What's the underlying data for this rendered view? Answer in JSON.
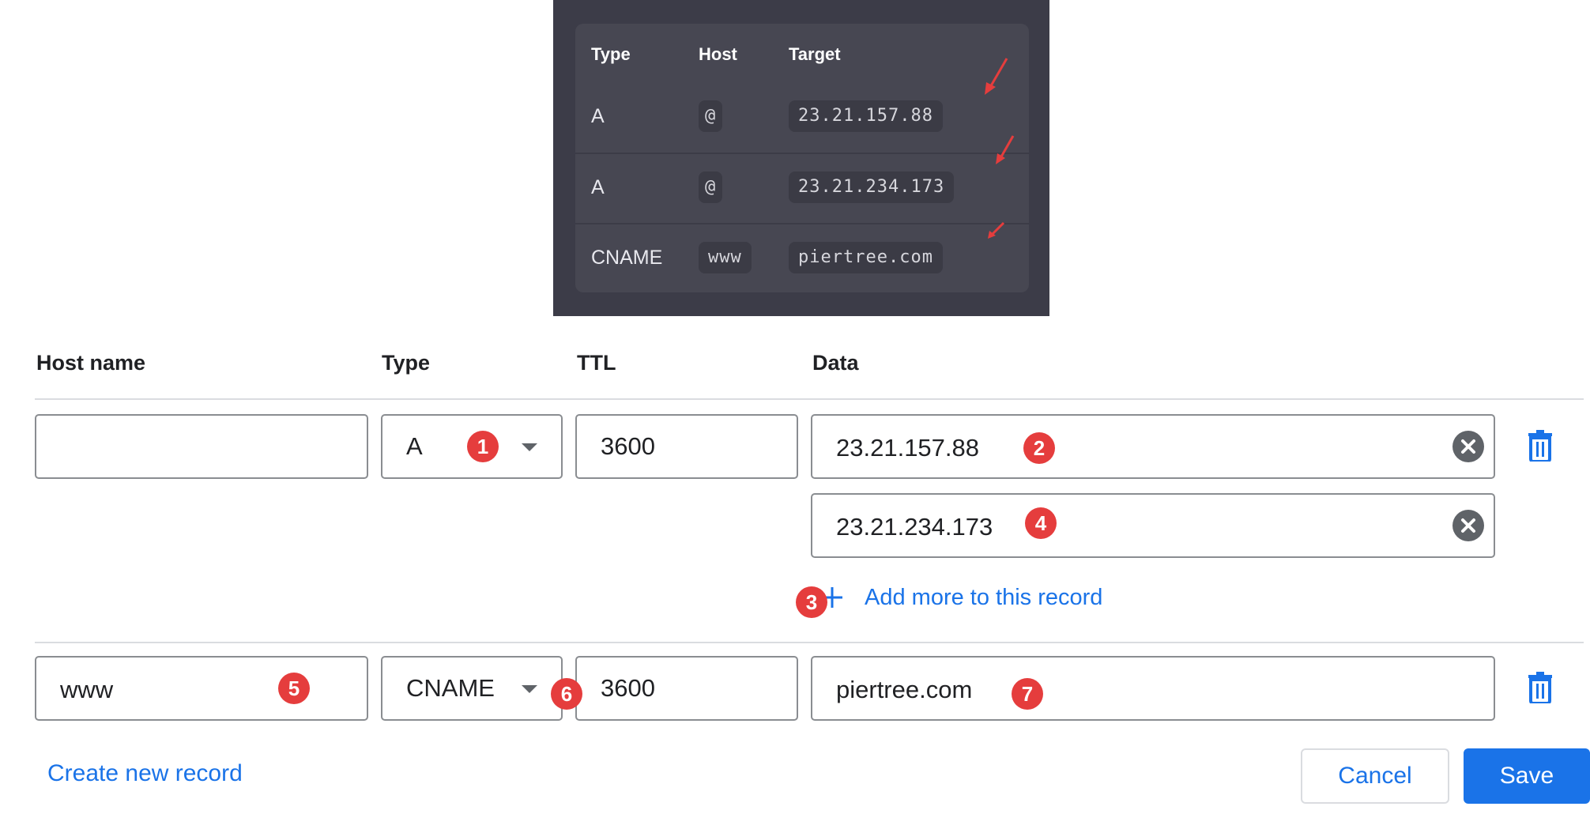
{
  "reference_table": {
    "headers": {
      "type": "Type",
      "host": "Host",
      "target": "Target"
    },
    "rows": [
      {
        "type": "A",
        "host": "@",
        "target": "23.21.157.88"
      },
      {
        "type": "A",
        "host": "@",
        "target": "23.21.234.173"
      },
      {
        "type": "CNAME",
        "host": "www",
        "target": "piertree.com"
      }
    ]
  },
  "form": {
    "headers": {
      "host_name": "Host name",
      "type": "Type",
      "ttl": "TTL",
      "data": "Data"
    },
    "record1": {
      "host_name": "",
      "type": "A",
      "ttl": "3600",
      "data": [
        "23.21.157.88",
        "23.21.234.173"
      ],
      "add_more_label": "Add more to this record"
    },
    "record2": {
      "host_name": "www",
      "type": "CNAME",
      "ttl": "3600",
      "data": "piertree.com"
    },
    "create_new_record": "Create new record",
    "cancel": "Cancel",
    "save": "Save"
  },
  "annotations": [
    "1",
    "2",
    "3",
    "4",
    "5",
    "6",
    "7"
  ],
  "colors": {
    "accent": "#1a73e8",
    "annotation_red": "#e53d3d",
    "panel_dark": "#3c3c48",
    "card_dark": "#474752"
  },
  "icons": {
    "type_dropdown": "chevron-down-icon",
    "clear": "clear-icon",
    "delete": "trash-icon",
    "add": "plus-icon"
  }
}
